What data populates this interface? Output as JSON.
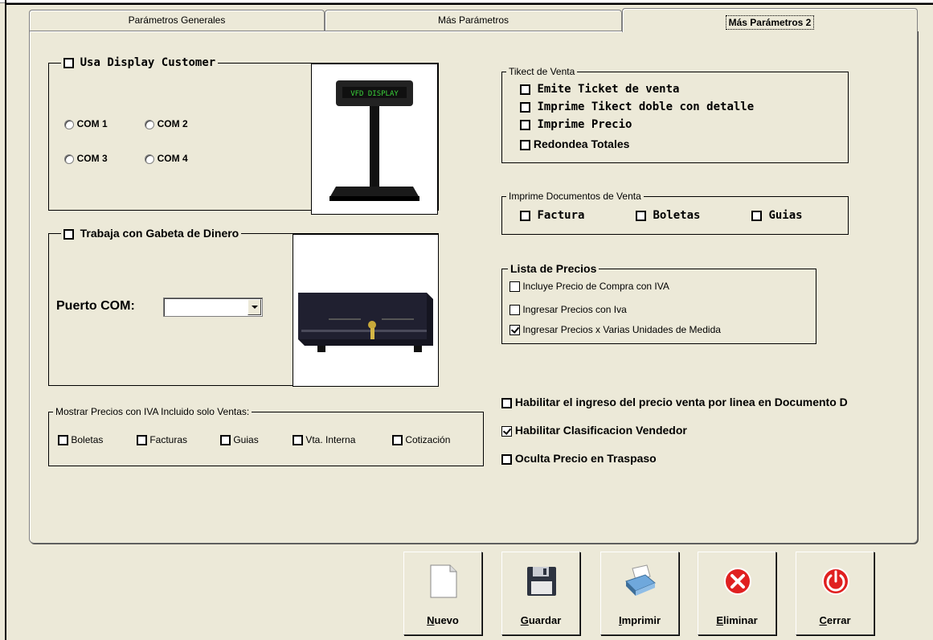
{
  "tabs": [
    {
      "label": "Parámetros Generales"
    },
    {
      "label": "Más Parámetros"
    },
    {
      "label": "Más Parámetros 2"
    }
  ],
  "display_group": {
    "title": "Usa Display Customer",
    "ports": [
      "COM 1",
      "COM 2",
      "COM 3",
      "COM 4"
    ],
    "display_text": "VFD DISPLAY"
  },
  "drawer_group": {
    "title": "Trabaja con Gabeta de Dinero",
    "port_label": "Puerto COM:",
    "port_value": ""
  },
  "iva_group": {
    "title": "Mostrar Precios con IVA Incluido solo Ventas:",
    "items": [
      "Boletas",
      "Facturas",
      "Guias",
      "Vta. Interna",
      "Cotización"
    ]
  },
  "ticket_group": {
    "title": "Tikect de Venta",
    "items": [
      "Emite Ticket de venta",
      "Imprime Tikect doble con detalle",
      "Imprime Precio",
      "Redondea Totales"
    ]
  },
  "docs_group": {
    "title": "Imprime Documentos de Venta",
    "items": [
      "Factura",
      "Boletas",
      "Guias"
    ]
  },
  "prices_group": {
    "title": "Lista de Precios",
    "items": [
      {
        "label": "Incluye Precio de Compra con IVA",
        "checked": false
      },
      {
        "label": "Ingresar Precios con Iva",
        "checked": false
      },
      {
        "label": "Ingresar Precios x Varias Unidades de Medida",
        "checked": true
      }
    ]
  },
  "options": [
    {
      "label": "Habilitar el ingreso del precio venta por linea en Documento D",
      "checked": false
    },
    {
      "label": "Habilitar Clasificacion Vendedor",
      "checked": true
    },
    {
      "label": "Oculta Precio en Traspaso",
      "checked": false
    }
  ],
  "buttons": [
    {
      "hotkey": "N",
      "rest": "uevo",
      "icon": "new-document-icon"
    },
    {
      "hotkey": "G",
      "rest": "uardar",
      "icon": "floppy-disk-icon"
    },
    {
      "hotkey": "I",
      "rest": "mprimir",
      "icon": "printer-icon"
    },
    {
      "hotkey": "E",
      "rest": "liminar",
      "icon": "delete-x-icon"
    },
    {
      "hotkey": "C",
      "rest": "errar",
      "icon": "power-icon"
    }
  ],
  "colors": {
    "background": "#ece9d8",
    "delete_red": "#e02020",
    "display_green": "#3ad23a"
  }
}
